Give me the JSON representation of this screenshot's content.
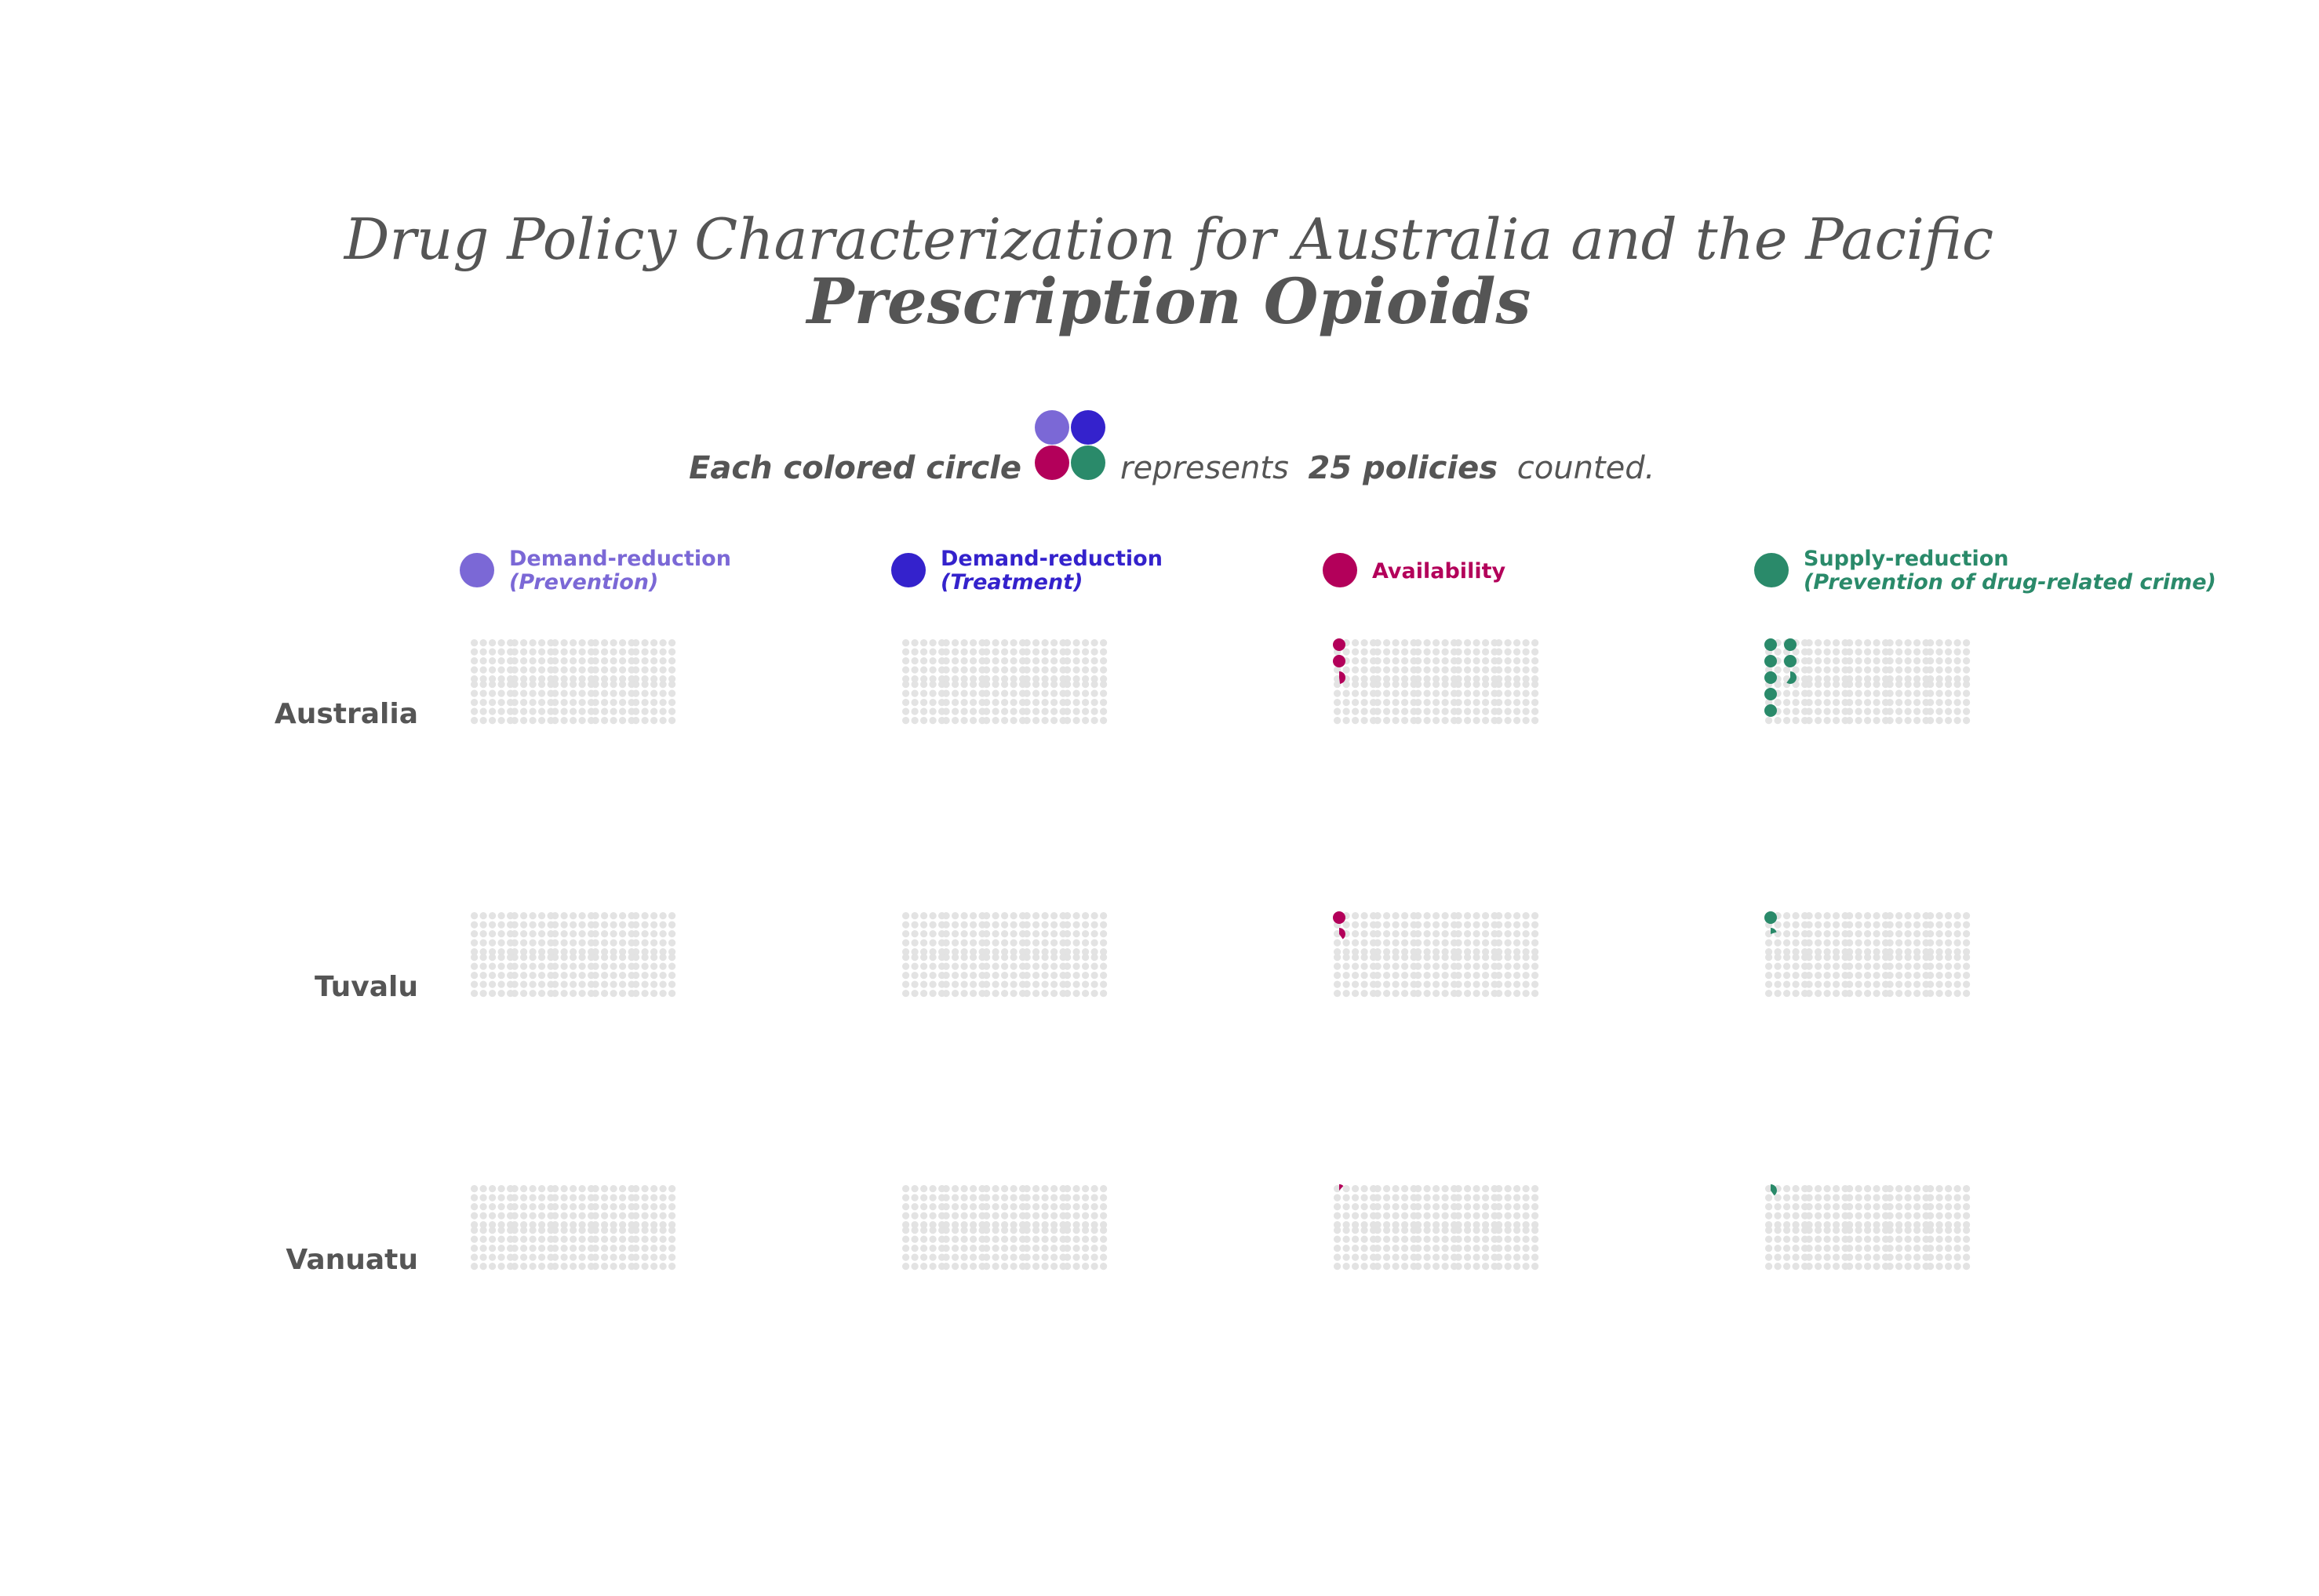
{
  "chart_data": {
    "type": "waffle",
    "title": "Drug Policy Characterization for Australia and the Pacific",
    "subtitle": "Prescription Opioids",
    "key": {
      "prefix": "Each colored circle",
      "middle": "represents",
      "emphasis": "25 policies",
      "suffix": "counted."
    },
    "categories": [
      {
        "line1": "Demand-reduction",
        "line2": "(Prevention)",
        "color": "#7b68d6"
      },
      {
        "line1": "Demand-reduction",
        "line2": "(Treatment)",
        "color": "#3422cc"
      },
      {
        "line1": "Availability",
        "line2": "",
        "color": "#b3005a"
      },
      {
        "line1": "Supply-reduction",
        "line2": "(Prevention of drug-related crime)",
        "color": "#2a8a6a"
      }
    ],
    "rows": [
      {
        "country": "Australia",
        "values": [
          0,
          0,
          62,
          190
        ]
      },
      {
        "country": "Tuvalu",
        "values": [
          0,
          0,
          35,
          30
        ]
      },
      {
        "country": "Vanuatu",
        "values": [
          0,
          0,
          3,
          10
        ]
      }
    ],
    "unit": 25,
    "grid_color": "#e3e3e3"
  }
}
